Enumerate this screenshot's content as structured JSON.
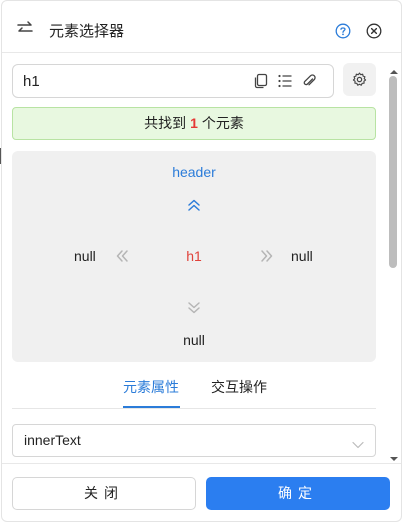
{
  "header": {
    "title": "元素选择器",
    "back_icon": "swap-arrows-icon",
    "help_icon": "question-circle-icon",
    "close_icon": "close-circle-icon"
  },
  "search": {
    "value": "h1",
    "tool_icons": [
      "copy-icon",
      "list-icon",
      "paperclip-icon"
    ],
    "settings_icon": "gear-icon"
  },
  "found": {
    "prefix": "共找到",
    "count": "1",
    "suffix": "个元素"
  },
  "navigator": {
    "parent": "header",
    "current": "h1",
    "prev_sibling": "null",
    "next_sibling": "null",
    "child": "null"
  },
  "tabs": [
    {
      "label": "元素属性",
      "active": true
    },
    {
      "label": "交互操作",
      "active": false
    }
  ],
  "attribute_select": {
    "value": "innerText"
  },
  "footer": {
    "close_label": "关闭",
    "ok_label": "确定"
  },
  "colors": {
    "accent": "#2b7cd9",
    "primary_button": "#2b7ef0",
    "highlight_red": "#e0423a",
    "success_bg": "#e8f8e0",
    "success_border": "#b8e3a3"
  }
}
